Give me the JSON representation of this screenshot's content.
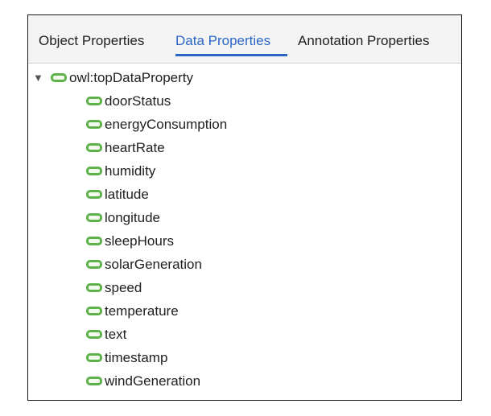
{
  "tabs": [
    {
      "label": "Object Properties"
    },
    {
      "label": "Data Properties"
    },
    {
      "label": "Annotation Properties"
    }
  ],
  "active_tab": "Data Properties",
  "root": {
    "label": "owl:topDataProperty",
    "expand_glyph": "▼",
    "icon": "data-property-icon"
  },
  "children": [
    {
      "label": "doorStatus"
    },
    {
      "label": "energyConsumption"
    },
    {
      "label": "heartRate"
    },
    {
      "label": "humidity"
    },
    {
      "label": "latitude"
    },
    {
      "label": "longitude"
    },
    {
      "label": "sleepHours"
    },
    {
      "label": "solarGeneration"
    },
    {
      "label": "speed"
    },
    {
      "label": "temperature"
    },
    {
      "label": "text"
    },
    {
      "label": "timestamp"
    },
    {
      "label": "windGeneration"
    }
  ],
  "colors": {
    "active_tab": "#2b66c6",
    "property_icon": "#5db34a"
  }
}
